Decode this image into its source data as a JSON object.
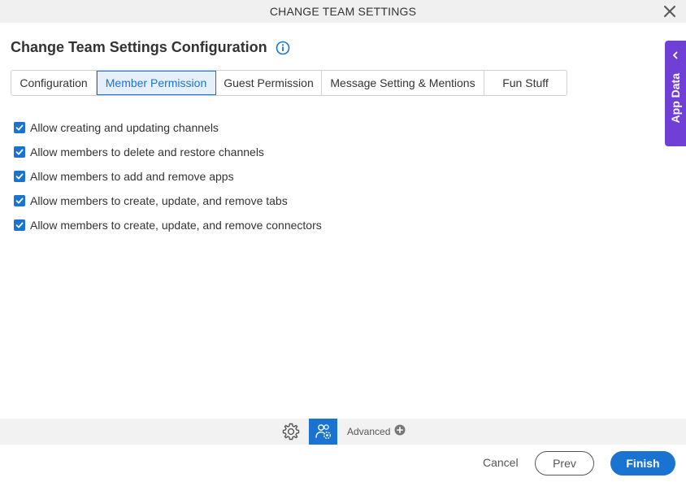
{
  "window": {
    "title": "CHANGE TEAM SETTINGS",
    "close_icon": "close-icon"
  },
  "heading": {
    "title": "Change Team Settings Configuration",
    "info_icon": "info-icon"
  },
  "tabs": [
    {
      "label": "Configuration",
      "active": false
    },
    {
      "label": "Member Permission",
      "active": true
    },
    {
      "label": "Guest Permission",
      "active": false
    },
    {
      "label": "Message Setting & Mentions",
      "active": false
    },
    {
      "label": "Fun Stuff",
      "active": false
    }
  ],
  "options": [
    {
      "label": "Allow creating and updating channels",
      "checked": true
    },
    {
      "label": "Allow members to delete and restore channels",
      "checked": true
    },
    {
      "label": "Allow members to add and remove apps",
      "checked": true
    },
    {
      "label": "Allow members to create, update, and remove tabs",
      "checked": true
    },
    {
      "label": "Allow members to create, update, and remove connectors",
      "checked": true
    }
  ],
  "side_panel": {
    "label": "App Data",
    "icon": "chevron-left-icon"
  },
  "toolbar": {
    "settings_icon": "gear-icon",
    "team_icon": "team-settings-icon",
    "advanced_label": "Advanced",
    "advanced_icon": "plus-circle-icon"
  },
  "footer": {
    "cancel_label": "Cancel",
    "prev_label": "Prev",
    "finish_label": "Finish"
  },
  "colors": {
    "primary": "#1a73d1",
    "side_panel": "#6f3fd6",
    "titlebar_bg": "#f0f0f0",
    "toolbar_bg": "#f2f2f2"
  }
}
